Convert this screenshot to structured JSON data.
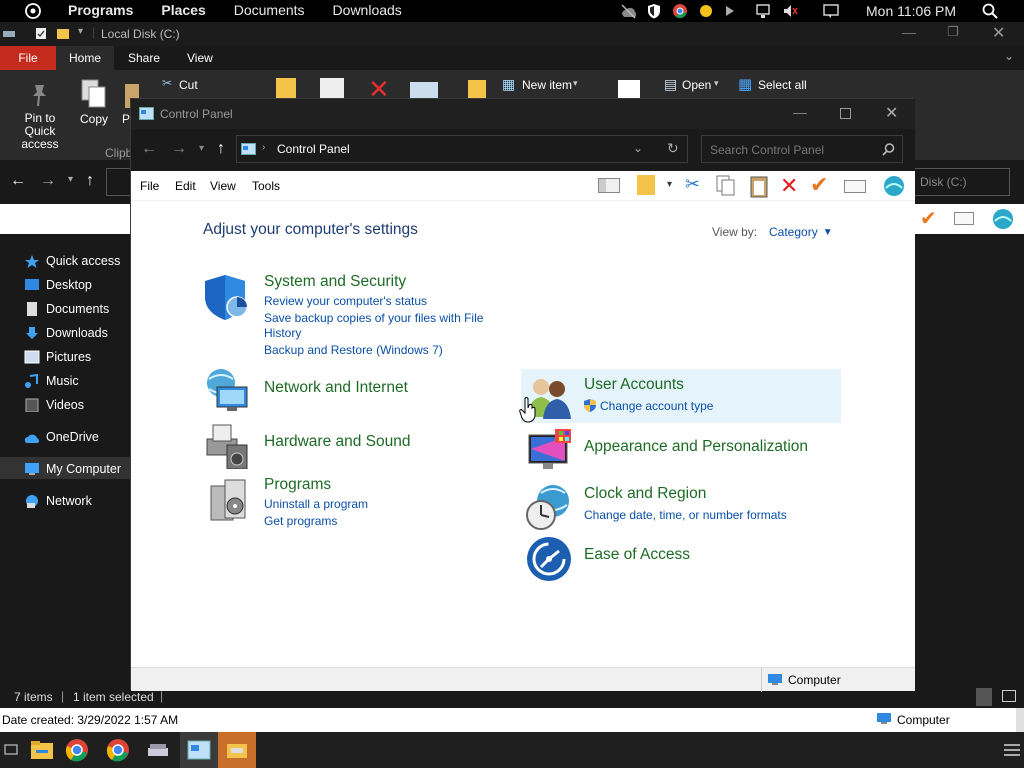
{
  "top_panel": {
    "menus": [
      "Programs",
      "Places",
      "Documents",
      "Downloads"
    ],
    "clock": "Mon 11:06 PM"
  },
  "explorer": {
    "title": "Local Disk (C:)",
    "ribbon_tabs": [
      "File",
      "Home",
      "Share",
      "View"
    ],
    "ribbon": {
      "pin_label": "Pin to Quick access",
      "copy_label": "Copy",
      "paste_label": "P",
      "cut_label": "Cut",
      "clipboard_label": "Clipb",
      "new_item_label": "New item",
      "open_label": "Open",
      "select_all_label": "Select all"
    },
    "address_partial": "Disk (C:)",
    "nav": [
      {
        "label": "Quick access",
        "icon": "star-icon"
      },
      {
        "label": "Desktop",
        "icon": "desktop-icon"
      },
      {
        "label": "Documents",
        "icon": "documents-icon"
      },
      {
        "label": "Downloads",
        "icon": "downloads-icon"
      },
      {
        "label": "Pictures",
        "icon": "pictures-icon"
      },
      {
        "label": "Music",
        "icon": "music-icon"
      },
      {
        "label": "Videos",
        "icon": "videos-icon"
      },
      {
        "label": "OneDrive",
        "icon": "cloud-icon"
      },
      {
        "label": "My Computer",
        "icon": "computer-icon"
      },
      {
        "label": "Network",
        "icon": "network-icon"
      }
    ],
    "status_items": "7 items",
    "status_selected": "1 item selected",
    "date_created": "Date created: 3/29/2022 1:57 AM",
    "computer_label": "Computer"
  },
  "control_panel": {
    "title": "Control Panel",
    "address": "Control Panel",
    "search_placeholder": "Search Control Panel",
    "menu": [
      "File",
      "Edit",
      "View",
      "Tools"
    ],
    "heading": "Adjust your computer's settings",
    "view_by_label": "View by:",
    "view_by_value": "Category",
    "categories": {
      "system": {
        "title": "System and Security",
        "links": [
          "Review your computer's status",
          "Save backup copies of your files with File",
          "History",
          "Backup and Restore (Windows 7)"
        ]
      },
      "network": {
        "title": "Network and Internet"
      },
      "hardware": {
        "title": "Hardware and Sound"
      },
      "programs": {
        "title": "Programs",
        "links": [
          "Uninstall a program",
          "Get programs"
        ]
      },
      "user": {
        "title": "User Accounts",
        "links": [
          "Change account type"
        ]
      },
      "appearance": {
        "title": "Appearance and Personalization"
      },
      "clock": {
        "title": "Clock and Region",
        "links": [
          "Change date, time, or number formats"
        ]
      },
      "ease": {
        "title": "Ease of Access"
      }
    },
    "status_computer": "Computer"
  },
  "colors": {
    "category_title": "#1e6b25",
    "link": "#0a4fa8",
    "heading": "#1e3d73",
    "hover_bg": "#e5f3fb"
  }
}
